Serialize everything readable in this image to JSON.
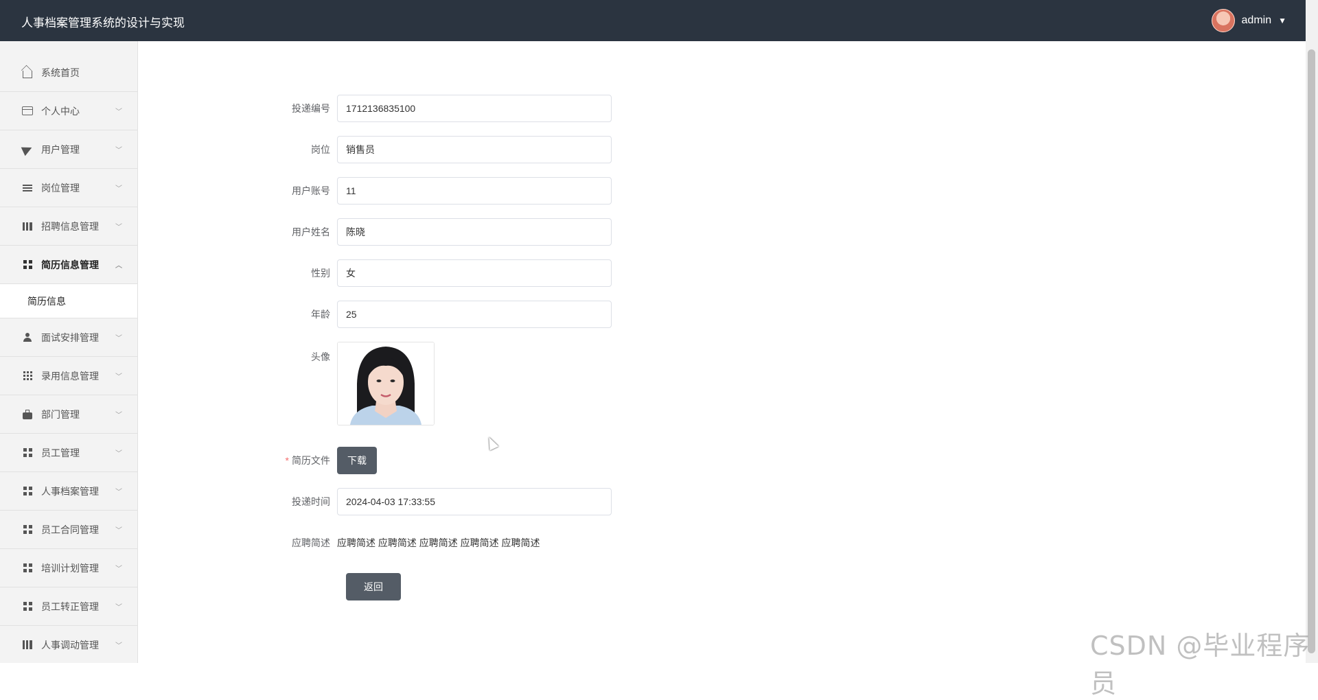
{
  "header": {
    "title": "人事档案管理系统的设计与实现",
    "username": "admin"
  },
  "sidebar": {
    "items": [
      {
        "label": "系统首页",
        "icon": "home-icon"
      },
      {
        "label": "个人中心",
        "icon": "card-icon"
      },
      {
        "label": "用户管理",
        "icon": "send-icon"
      },
      {
        "label": "岗位管理",
        "icon": "list-icon"
      },
      {
        "label": "招聘信息管理",
        "icon": "books-icon"
      },
      {
        "label": "简历信息管理",
        "icon": "grid-icon",
        "open": true
      },
      {
        "label": "面试安排管理",
        "icon": "person-icon"
      },
      {
        "label": "录用信息管理",
        "icon": "grid9-icon"
      },
      {
        "label": "部门管理",
        "icon": "briefcase-icon"
      },
      {
        "label": "员工管理",
        "icon": "grid-icon"
      },
      {
        "label": "人事档案管理",
        "icon": "grid-icon"
      },
      {
        "label": "员工合同管理",
        "icon": "grid-icon"
      },
      {
        "label": "培训计划管理",
        "icon": "grid-icon"
      },
      {
        "label": "员工转正管理",
        "icon": "grid-icon"
      },
      {
        "label": "人事调动管理",
        "icon": "bar-chart-icon"
      }
    ],
    "submenu": {
      "label": "简历信息"
    }
  },
  "form": {
    "delivery_no": {
      "label": "投递编号",
      "value": "1712136835100"
    },
    "position": {
      "label": "岗位",
      "value": "销售员"
    },
    "account": {
      "label": "用户账号",
      "value": "11"
    },
    "name": {
      "label": "用户姓名",
      "value": "陈晓"
    },
    "gender": {
      "label": "性别",
      "value": "女"
    },
    "age": {
      "label": "年龄",
      "value": "25"
    },
    "avatar": {
      "label": "头像"
    },
    "resume": {
      "label": "简历文件",
      "required_mark": "*",
      "button": "下载"
    },
    "delivery_time": {
      "label": "投递时间",
      "value": "2024-04-03 17:33:55"
    },
    "description": {
      "label": "应聘简述",
      "value": "应聘简述 应聘简述 应聘简述 应聘简述 应聘简述"
    },
    "back_button": "返回"
  },
  "watermark": "CSDN @毕业程序员",
  "colors": {
    "header_bg": "#2b3440",
    "sidebar_bg": "#f3f3f3",
    "button_bg": "#545c66",
    "required": "#f56c6c"
  }
}
